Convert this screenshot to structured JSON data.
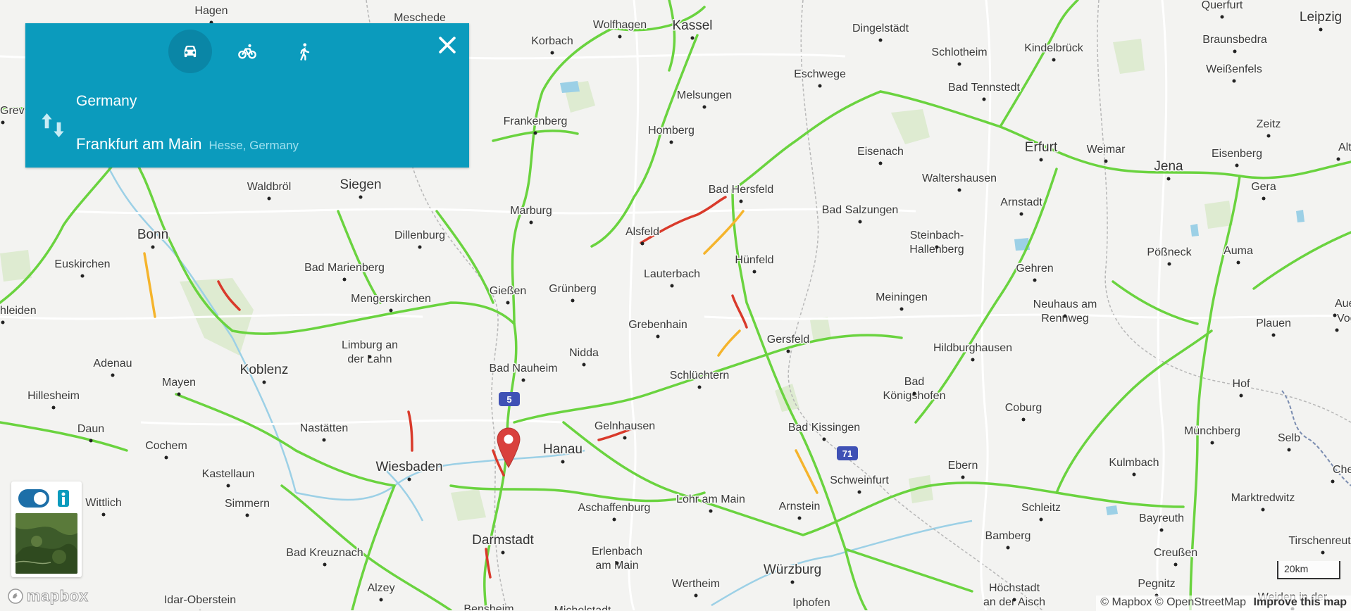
{
  "directions_panel": {
    "modes": [
      {
        "name": "driving",
        "icon": "car-icon",
        "active": true
      },
      {
        "name": "cycling",
        "icon": "bicycle-icon",
        "active": false
      },
      {
        "name": "walking",
        "icon": "walking-icon",
        "active": false
      }
    ],
    "origin": "Germany",
    "destination": "Frankfurt am Main",
    "destination_context": "Hesse, Germany",
    "accent_color": "#0b9bbd"
  },
  "map": {
    "places": [
      "Hagen",
      "Meschede",
      "Wolfhagen",
      "Kassel",
      "Dingelstädt",
      "Querfurt",
      "Leipzig",
      "Korbach",
      "Schlotheim",
      "Kindelbrück",
      "Braunsbedra",
      "Weißenfels",
      "Eschwege",
      "Melsungen",
      "Bad Tennstedt",
      "Frankenberg",
      "Homberg",
      "Zeitz",
      "Erfurt",
      "Weimar",
      "Jena",
      "Eisenberg",
      "Eisenach",
      "Waltershausen",
      "Gera",
      "Siegen",
      "Waldbröl",
      "Bad Hersfeld",
      "Arnstadt",
      "Bad Salzungen",
      "Marburg",
      "Bonn",
      "Dillenburg",
      "Alsfeld",
      "Steinbach-Hallenberg",
      "Euskirchen",
      "Hünfeld",
      "Pößneck",
      "Auma",
      "Bad Marienberg",
      "Lauterbach",
      "Gehren",
      "Gießen",
      "Grünberg",
      "Mengerskirchen",
      "Meiningen",
      "Neuhaus am Rennweg",
      "Plauen",
      "Grebenhain",
      "Gersfeld",
      "Hildburghausen",
      "Limburg an der Lahn",
      "Nidda",
      "Adenau",
      "Koblenz",
      "Bad Nauheim",
      "Schlüchtern",
      "Bad Königshofen",
      "Mayen",
      "Hillesheim",
      "Hof",
      "Coburg",
      "Gelnhausen",
      "Nastätten",
      "Bad Kissingen",
      "Daun",
      "Hanau",
      "Münchberg",
      "Cochem",
      "Wiesbaden",
      "Ebern",
      "Kulmbach",
      "Kastellaun",
      "Schweinfurt",
      "Lohr am Main",
      "Aschaffenburg",
      "Arnstein",
      "Marktredwitz",
      "Simmern",
      "Wittlich",
      "Schleitz",
      "Darmstadt",
      "Bayreuth",
      "Bamberg",
      "Tirschenreuth",
      "Erlenbach am Main",
      "Bad Kreuznach",
      "Creußen",
      "Würzburg",
      "Alzey",
      "Wertheim",
      "Pegnitz",
      "Idar-Oberstein",
      "Höchstadt an der Aisch",
      "Iphofen",
      "Bensheim",
      "Michelstadt",
      "Weiden in der",
      "Grev",
      "hleiden",
      "Selb",
      "Che",
      "Vogt",
      "Auerb",
      "Alte"
    ],
    "highway_shields": [
      "5",
      "71"
    ],
    "scale_label": "20km",
    "traffic_colors": {
      "free": "#6ad33f",
      "slow": "#f5b42c",
      "heavy": "#d93a2b"
    }
  },
  "controls": {
    "traffic_toggle": true,
    "logo_text": "mapbox"
  },
  "attribution": {
    "mapbox": "© Mapbox",
    "osm": "© OpenStreetMap",
    "improve": "Improve this map"
  }
}
